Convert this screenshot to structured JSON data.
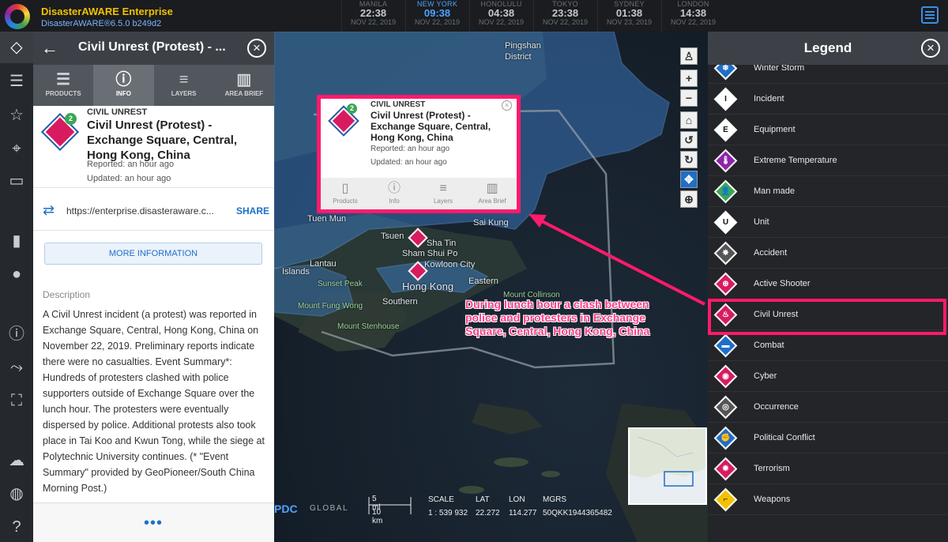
{
  "app": {
    "title": "DisasterAWARE Enterprise",
    "version": "DisasterAWARE®6.5.0 b249d2"
  },
  "clocks": [
    {
      "city": "MANILA",
      "time": "22:38",
      "date": "NOV 22, 2019",
      "active": false
    },
    {
      "city": "NEW YORK",
      "time": "09:38",
      "date": "NOV 22, 2019",
      "active": true
    },
    {
      "city": "HONOLULU",
      "time": "04:38",
      "date": "NOV 22, 2019",
      "active": false
    },
    {
      "city": "TOKYO",
      "time": "23:38",
      "date": "NOV 22, 2019",
      "active": false
    },
    {
      "city": "SYDNEY",
      "time": "01:38",
      "date": "NOV 23, 2019",
      "active": false
    },
    {
      "city": "LONDON",
      "time": "14:38",
      "date": "NOV 22, 2019",
      "active": false
    }
  ],
  "panel": {
    "title": "Civil Unrest (Protest) - ...",
    "tabs": [
      {
        "label": "PRODUCTS",
        "icon": "list-icon"
      },
      {
        "label": "INFO",
        "icon": "info-icon"
      },
      {
        "label": "LAYERS",
        "icon": "layers-icon"
      },
      {
        "label": "AREA BRIEF",
        "icon": "chart-icon"
      }
    ],
    "badge": "2",
    "event_type": "CIVIL UNREST",
    "event_name": "Civil Unrest (Protest) - Exchange Square, Central, Hong Kong, China",
    "reported": "Reported: an hour ago",
    "updated": "Updated: an hour ago",
    "link": "https://enterprise.disasteraware.c...",
    "share_label": "SHARE",
    "more_info_label": "MORE INFORMATION",
    "description_heading": "Description",
    "description": "A Civil Unrest incident (a protest) was reported in Exchange Square, Central, Hong Kong, China on November 22, 2019. Preliminary reports indicate there were no casualties. Event Summary*: Hundreds of protesters clashed with police supporters outside of Exchange Square over the lunch hour. The protesters were eventually dispersed by police. Additional protests also took place in Tai Koo and Kwun Tong, while the siege at Polytechnic University continues. (* \"Event Summary\" provided by GeoPioneer/South China Morning Post.)",
    "more_dots": "•••"
  },
  "popup": {
    "badge": "2",
    "event_type": "CIVIL UNREST",
    "event_name": "Civil Unrest (Protest) - Exchange Square, Central, Hong Kong, China",
    "reported": "Reported: an hour ago",
    "updated": "Updated: an hour ago",
    "tabs": [
      "Products",
      "Info",
      "Layers",
      "Area Brief"
    ]
  },
  "map": {
    "labels": [
      {
        "text": "Pingshan",
        "cls": ""
      },
      {
        "text": "District",
        "cls": ""
      },
      {
        "text": "Sha Tin",
        "cls": ""
      },
      {
        "text": "Sai Kung",
        "cls": ""
      },
      {
        "text": "Tuen Mun",
        "cls": ""
      },
      {
        "text": "Tsuen",
        "cls": ""
      },
      {
        "text": "Sham Shui Po",
        "cls": ""
      },
      {
        "text": "Kowloon City",
        "cls": ""
      },
      {
        "text": "Hong Kong",
        "cls": "big"
      },
      {
        "text": "Eastern",
        "cls": ""
      },
      {
        "text": "Southern",
        "cls": ""
      },
      {
        "text": "Islands",
        "cls": ""
      },
      {
        "text": "Sunset Peak",
        "cls": "green"
      },
      {
        "text": "Mount Collinson",
        "cls": "green"
      },
      {
        "text": "Mount Fung Wong",
        "cls": "green"
      },
      {
        "text": "Mount Stenhouse",
        "cls": "green"
      },
      {
        "text": "Lantau",
        "cls": ""
      }
    ],
    "callout": "During lunch hour a clash between police and protesters in Exchange Square, Central, Hong Kong, China",
    "controls": [
      "pegman-icon",
      "zoom-in-icon",
      "zoom-out-icon",
      "home-icon",
      "rotate-left-icon",
      "rotate-right-icon",
      "pan-icon",
      "zoom-box-icon"
    ],
    "scale_mi": "5 mi",
    "scale_km": "10 km",
    "readout": {
      "scale_label": "SCALE",
      "scale": "1 : 539 932",
      "lat_label": "LAT",
      "lat": "22.272",
      "lon_label": "LON",
      "lon": "114.277",
      "mgrs_label": "MGRS",
      "mgrs": "50QKK1944365482"
    },
    "brand": "PDC",
    "brand_sub": "GLOBAL"
  },
  "legend": {
    "title": "Legend",
    "items": [
      {
        "label": "Winter Storm",
        "color": "#1e6fc8",
        "glyph": "❄"
      },
      {
        "label": "Incident",
        "color": "#ffffff",
        "glyph": "I"
      },
      {
        "label": "Equipment",
        "color": "#ffffff",
        "glyph": "E"
      },
      {
        "label": "Extreme Temperature",
        "color": "#8e24aa",
        "glyph": "🌡"
      },
      {
        "label": "Man made",
        "color": "#3aa655",
        "glyph": "👤"
      },
      {
        "label": "Unit",
        "color": "#ffffff",
        "glyph": "U"
      },
      {
        "label": "Accident",
        "color": "#555555",
        "glyph": "✸"
      },
      {
        "label": "Active Shooter",
        "color": "#d81b60",
        "glyph": "⊕"
      },
      {
        "label": "Civil Unrest",
        "color": "#d81b60",
        "glyph": "♨"
      },
      {
        "label": "Combat",
        "color": "#1e6fc8",
        "glyph": "▬"
      },
      {
        "label": "Cyber",
        "color": "#d81b60",
        "glyph": "◉"
      },
      {
        "label": "Occurrence",
        "color": "#555555",
        "glyph": "◎"
      },
      {
        "label": "Political Conflict",
        "color": "#1e6fc8",
        "glyph": "✊"
      },
      {
        "label": "Terrorism",
        "color": "#d81b60",
        "glyph": "✹"
      },
      {
        "label": "Weapons",
        "color": "#f2c100",
        "glyph": "⌐"
      }
    ]
  }
}
